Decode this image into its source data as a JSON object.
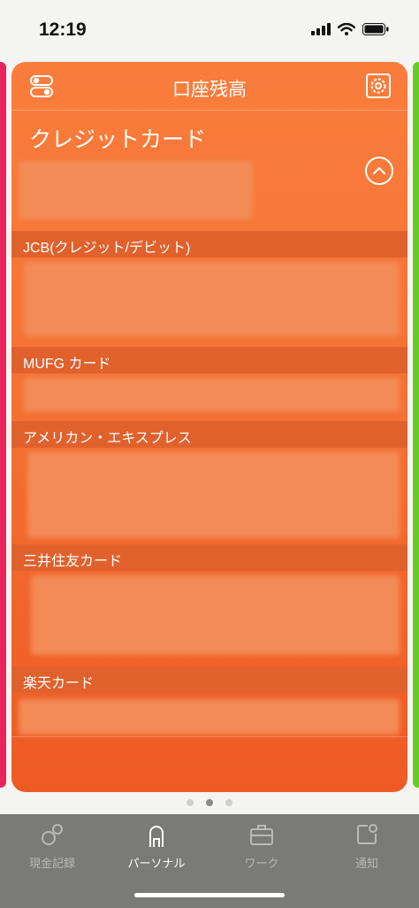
{
  "status_bar": {
    "time": "12:19",
    "icons": [
      "signal-icon",
      "wifi-icon",
      "battery-icon"
    ]
  },
  "card": {
    "title": "口座残高",
    "subtitle": "クレジットカード",
    "left_icon": "toggle-icon",
    "right_icon": "settings-icon",
    "collapse_icon": "chevron-up-icon",
    "sections": [
      {
        "label": "JCB(クレジット/デビット)"
      },
      {
        "label": "MUFG カード"
      },
      {
        "label": "アメリカン・エキスプレス"
      },
      {
        "label": "三井住友カード"
      },
      {
        "label": "楽天カード"
      }
    ],
    "colors": {
      "card_top": "#fa7d3c",
      "card_bottom": "#ee5a24",
      "section_bg": "#e1612d"
    }
  },
  "pager": {
    "count": 3,
    "active": 2
  },
  "tab_bar": {
    "tabs": [
      {
        "label": "現金記録",
        "icon": "cash-record-icon",
        "active": false
      },
      {
        "label": "パーソナル",
        "icon": "person-icon",
        "active": true
      },
      {
        "label": "ワーク",
        "icon": "briefcase-icon",
        "active": false
      },
      {
        "label": "通知",
        "icon": "notification-icon",
        "active": false
      }
    ]
  },
  "side_colors": {
    "left": "#e8245a",
    "right": "#66cc22"
  }
}
